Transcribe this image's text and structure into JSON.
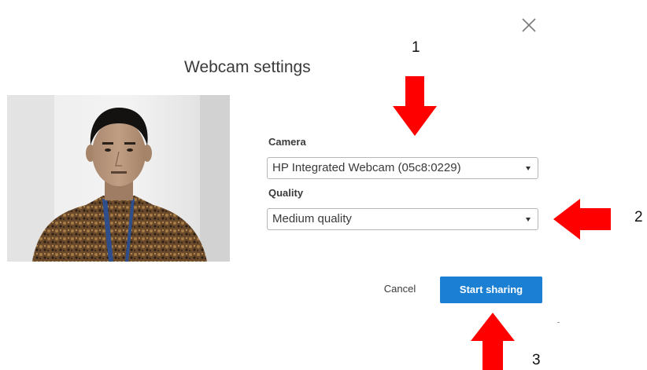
{
  "dialog": {
    "title": "Webcam settings"
  },
  "icons": {
    "close": "close-icon"
  },
  "camera": {
    "label": "Camera",
    "selected": "HP Integrated Webcam (05c8:0229)"
  },
  "quality": {
    "label": "Quality",
    "selected": "Medium quality"
  },
  "actions": {
    "cancel_label": "Cancel",
    "start_label": "Start sharing"
  },
  "annotations": {
    "camera_number": "1",
    "quality_number": "2",
    "start_number": "3"
  },
  "colors": {
    "primary_button": "#1b7fd4",
    "annotation_arrow": "#ff0000"
  }
}
